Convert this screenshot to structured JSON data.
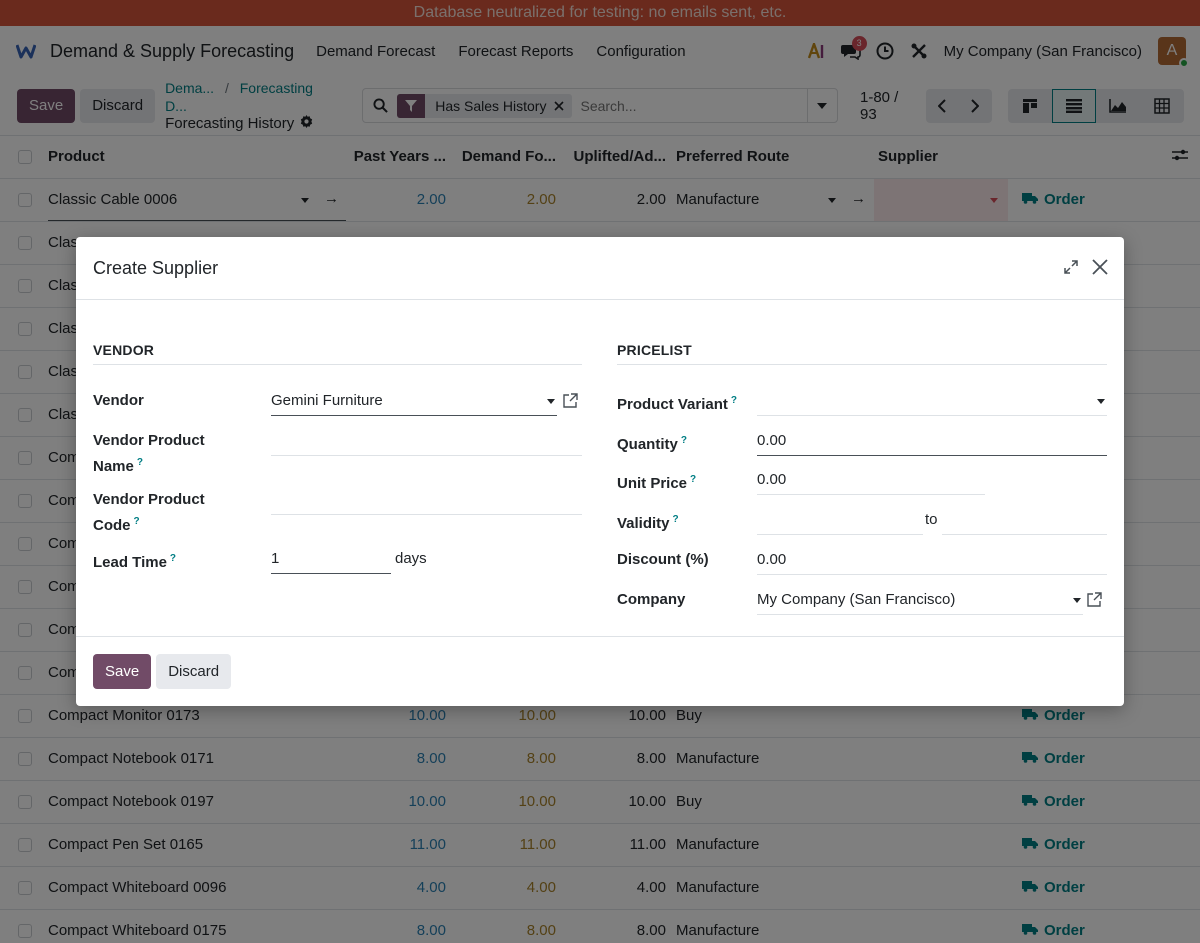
{
  "banner": "Database neutralized for testing: no emails sent, etc.",
  "navbar": {
    "app_name": "Demand & Supply Forecasting",
    "menus": [
      "Demand Forecast",
      "Forecast Reports",
      "Configuration"
    ],
    "messages_count": "3",
    "company": "My Company (San Francisco)",
    "avatar_letter": "A"
  },
  "control": {
    "save_label": "Save",
    "discard_label": "Discard",
    "breadcrumb": [
      "Dema...",
      "Forecasting D..."
    ],
    "current": "Forecasting History",
    "facet": "Has Sales History",
    "search_placeholder": "Search...",
    "pager": "1-80 / 93"
  },
  "table": {
    "headers": [
      "Product",
      "Past Years ...",
      "Demand Fo...",
      "Uplifted/Ad...",
      "Preferred Route",
      "Supplier"
    ],
    "first_row": {
      "product": "Classic Cable 0006",
      "past": "2.00",
      "demand": "2.00",
      "uplift": "2.00",
      "route": "Manufacture"
    },
    "hidden_rows": [
      "Clas",
      "Clas",
      "Clas",
      "Clas",
      "Clas",
      "Com",
      "Com",
      "Com",
      "Com",
      "Com",
      "Com"
    ],
    "rows": [
      {
        "product": "Compact Monitor 0173",
        "past": "10.00",
        "demand": "10.00",
        "uplift": "10.00",
        "route": "Buy",
        "order": "Order"
      },
      {
        "product": "Compact Notebook 0171",
        "past": "8.00",
        "demand": "8.00",
        "uplift": "8.00",
        "route": "Manufacture",
        "order": "Order"
      },
      {
        "product": "Compact Notebook 0197",
        "past": "10.00",
        "demand": "10.00",
        "uplift": "10.00",
        "route": "Buy",
        "order": "Order"
      },
      {
        "product": "Compact Pen Set 0165",
        "past": "11.00",
        "demand": "11.00",
        "uplift": "11.00",
        "route": "Manufacture",
        "order": "Order"
      },
      {
        "product": "Compact Whiteboard 0096",
        "past": "4.00",
        "demand": "4.00",
        "uplift": "4.00",
        "route": "Manufacture",
        "order": "Order"
      },
      {
        "product": "Compact Whiteboard 0175",
        "past": "8.00",
        "demand": "8.00",
        "uplift": "8.00",
        "route": "Manufacture",
        "order": "Order"
      }
    ],
    "order_label": "Order"
  },
  "modal": {
    "title": "Create Supplier",
    "vendor_group": "VENDOR",
    "pricelist_group": "PRICELIST",
    "vendor_label": "Vendor",
    "vendor_value": "Gemini Furniture",
    "vendor_product_name_label_1": "Vendor Product",
    "vendor_product_name_label_2": "Name",
    "vendor_product_code_label_1": "Vendor Product",
    "vendor_product_code_label_2": "Code",
    "lead_time_label": "Lead Time",
    "lead_time_value": "1",
    "lead_time_unit": "days",
    "product_variant_label": "Product Variant",
    "quantity_label": "Quantity",
    "quantity_value": "0.00",
    "unit_price_label": "Unit Price",
    "unit_price_value": "0.00",
    "validity_label": "Validity",
    "validity_to": "to",
    "discount_label": "Discount (%)",
    "discount_value": "0.00",
    "company_label": "Company",
    "company_value": "My Company (San Francisco)",
    "help_mark": "?",
    "save_label": "Save",
    "discard_label": "Discard"
  }
}
